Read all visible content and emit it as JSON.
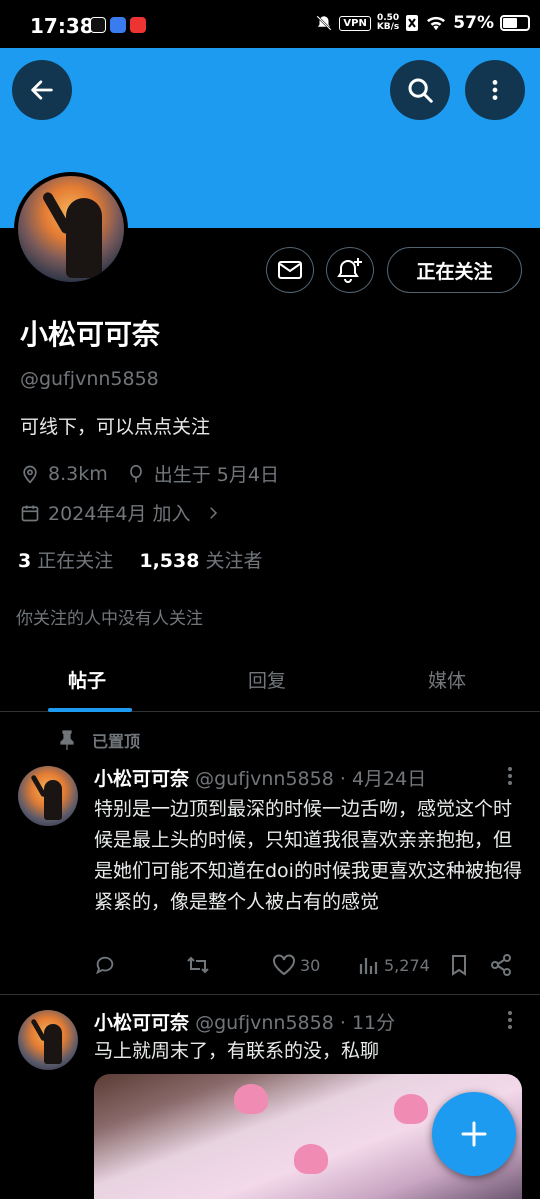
{
  "status_bar": {
    "time": "17:38",
    "vpn": "VPN",
    "speed_value": "0.50",
    "speed_unit": "KB/s",
    "battery": "57%"
  },
  "header": {
    "back_icon": "arrow-left-icon",
    "search_icon": "search-icon",
    "more_icon": "more-vertical-icon",
    "banner_color": "#1d9bf0"
  },
  "profile": {
    "name": "小松可可奈",
    "handle": "@gufjvnn5858",
    "bio": "可线下，可以点点关注",
    "location": "8.3km",
    "birthday": "出生于 5月4日",
    "joined": "2024年4月 加入",
    "following_count": "3",
    "following_label": "正在关注",
    "followers_count": "1,538",
    "followers_label": "关注者",
    "mutual_note": "你关注的人中没有人关注",
    "follow_button": "正在关注"
  },
  "tabs": [
    {
      "label": "帖子",
      "active": true
    },
    {
      "label": "回复",
      "active": false
    },
    {
      "label": "媒体",
      "active": false
    }
  ],
  "pinned_label": "已置顶",
  "posts": [
    {
      "name": "小松可可奈",
      "handle": "@gufjvnn5858",
      "time": "· 4月24日",
      "text": "特别是一边顶到最深的时候一边舌吻，感觉这个时候是最上头的时候，只知道我很喜欢亲亲抱抱，但是她们可能不知道在doi的时候我更喜欢这种被抱得紧紧的，像是整个人被占有的感觉",
      "likes": "30",
      "views": "5,274"
    },
    {
      "name": "小松可可奈",
      "handle": "@gufjvnn5858",
      "time": "· 11分",
      "text": "马上就周末了，有联系的没，私聊"
    }
  ],
  "fab_icon": "plus-icon",
  "accent": "#1d9bf0"
}
